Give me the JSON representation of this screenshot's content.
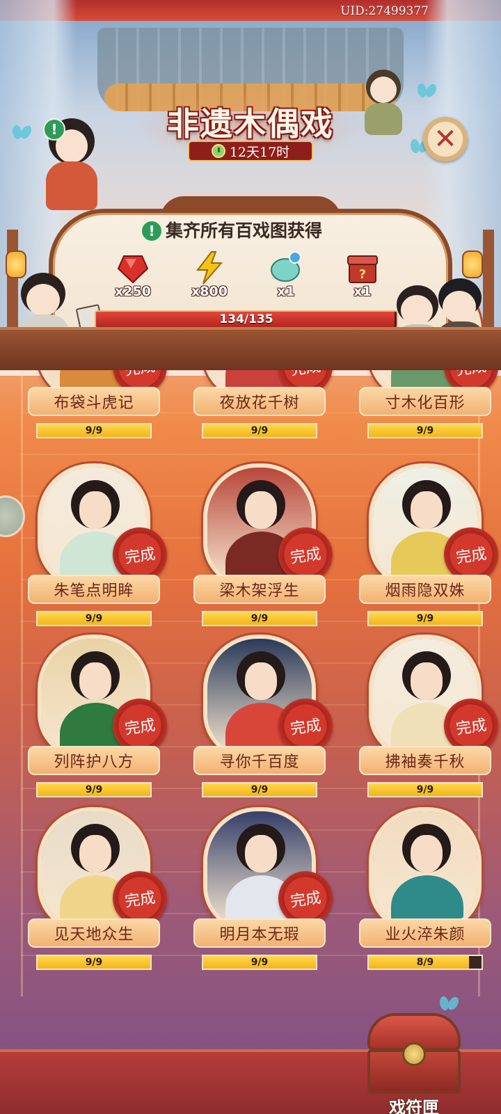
{
  "uid": "UID:27499377",
  "event": {
    "title": "非遗木偶戏",
    "timer": "12天17时"
  },
  "collect": {
    "text": "集齐所有百戏图获得",
    "rewards": [
      {
        "icon": "red-gem-icon",
        "qty": "x250",
        "color": "#d9302a"
      },
      {
        "icon": "lightning-icon",
        "qty": "x800",
        "color": "#f4c21a"
      },
      {
        "icon": "jade-orb-icon",
        "qty": "x1",
        "color": "#7fd3c6"
      },
      {
        "icon": "mystery-box-icon",
        "qty": "x1",
        "color": "#c0392b"
      }
    ],
    "progress_text": "134/135",
    "progress": 0.9926
  },
  "seal_label": "完成",
  "cards": [
    {
      "name": "布袋斗虎记",
      "progress": "9/9",
      "ratio": 1,
      "complete": true,
      "bg": "#e9b98a",
      "robe": "#d98a3a"
    },
    {
      "name": "夜放花千树",
      "progress": "9/9",
      "ratio": 1,
      "complete": true,
      "bg": "#f3d5c2",
      "robe": "#c9413a"
    },
    {
      "name": "寸木化百形",
      "progress": "9/9",
      "ratio": 1,
      "complete": true,
      "bg": "#f1e0c6",
      "robe": "#6a9a6a"
    },
    {
      "name": "朱笔点明眸",
      "progress": "9/9",
      "ratio": 1,
      "complete": true,
      "bg": "#f4ebde",
      "robe": "#cfe6d4"
    },
    {
      "name": "梁木架浮生",
      "progress": "9/9",
      "ratio": 1,
      "complete": true,
      "bg": "#b8473a",
      "robe": "#7a2a22"
    },
    {
      "name": "烟雨隐双姝",
      "progress": "9/9",
      "ratio": 1,
      "complete": true,
      "bg": "#eef0e6",
      "robe": "#e7c95a"
    },
    {
      "name": "列阵护八方",
      "progress": "9/9",
      "ratio": 1,
      "complete": true,
      "bg": "#e9d3a6",
      "robe": "#2f7a3e"
    },
    {
      "name": "寻你千百度",
      "progress": "9/9",
      "ratio": 1,
      "complete": true,
      "bg": "#2a3a5a",
      "robe": "#d8463a"
    },
    {
      "name": "拂袖奏千秋",
      "progress": "9/9",
      "ratio": 1,
      "complete": true,
      "bg": "#f4ecdf",
      "robe": "#efe0b8"
    },
    {
      "name": "见天地众生",
      "progress": "9/9",
      "ratio": 1,
      "complete": true,
      "bg": "#e8dcc8",
      "robe": "#f0d48a"
    },
    {
      "name": "明月本无瑕",
      "progress": "9/9",
      "ratio": 1,
      "complete": true,
      "bg": "#35406a",
      "robe": "#e4e6ee"
    },
    {
      "name": "业火淬朱颜",
      "progress": "8/9",
      "ratio": 0.889,
      "complete": false,
      "bg": "#f2dcc0",
      "robe": "#2f8a8a"
    }
  ],
  "chest_button": "戏符匣"
}
